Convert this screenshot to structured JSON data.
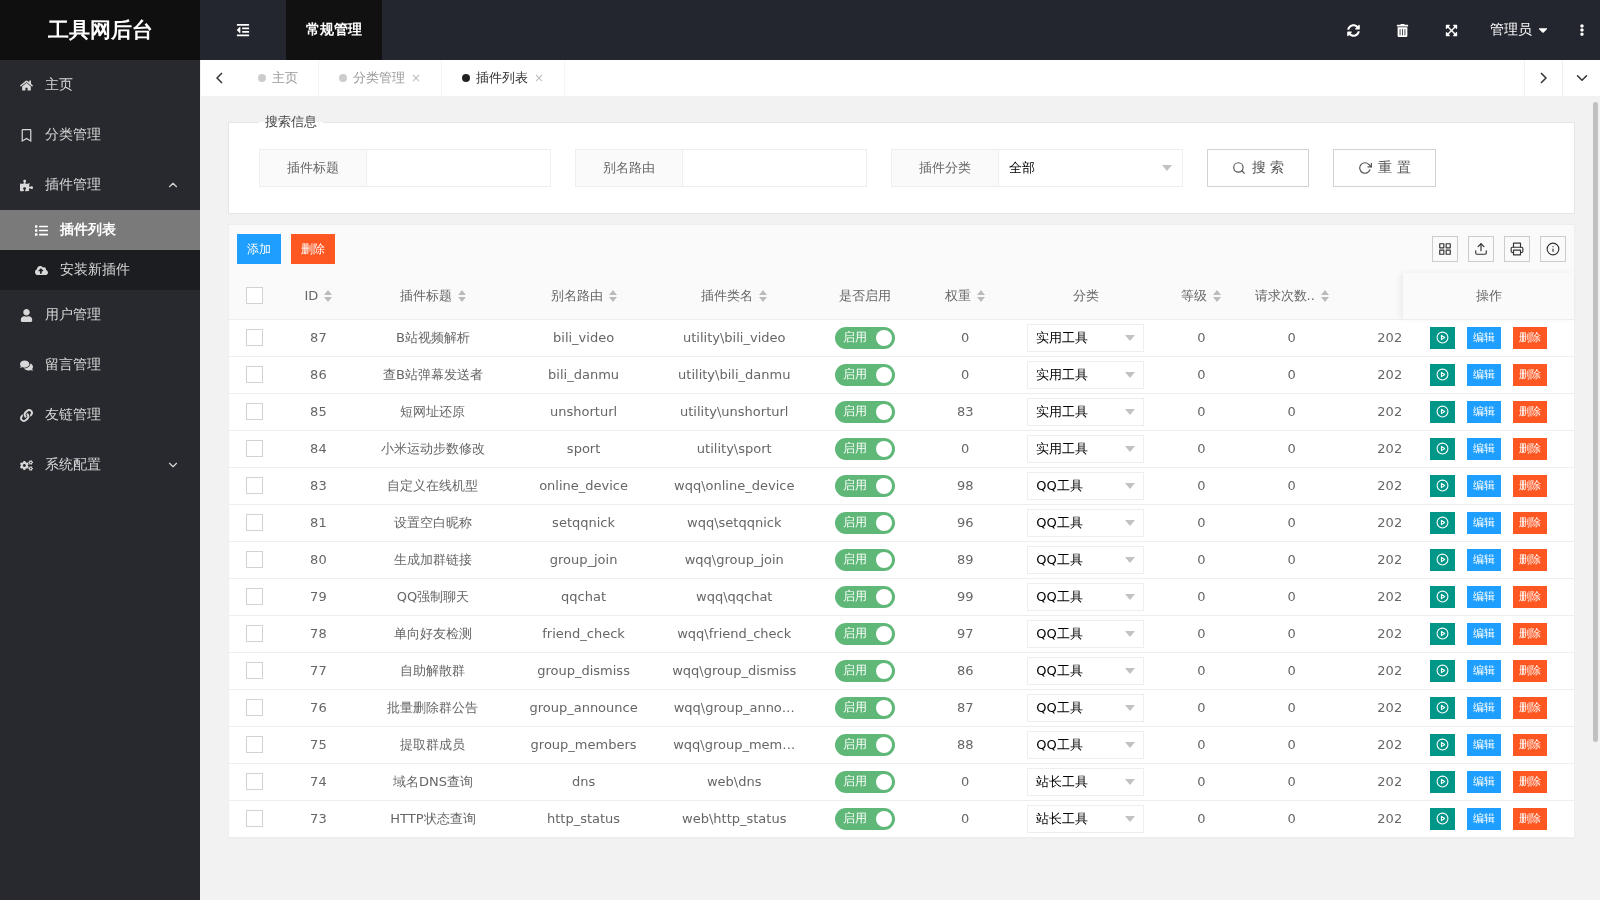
{
  "header": {
    "logo": "工具网后台",
    "nav": [
      {
        "label": "常规管理",
        "selected": true
      }
    ],
    "user": "管理员"
  },
  "sidebar": {
    "items": [
      {
        "label": "主页",
        "selected": false
      },
      {
        "label": "分类管理",
        "selected": false
      },
      {
        "label": "插件管理",
        "selected": false,
        "expanded": true,
        "children": [
          {
            "label": "插件列表",
            "selected": true
          },
          {
            "label": "安装新插件",
            "selected": false
          }
        ]
      },
      {
        "label": "用户管理",
        "selected": false
      },
      {
        "label": "留言管理",
        "selected": false
      },
      {
        "label": "友链管理",
        "selected": false
      },
      {
        "label": "系统配置",
        "selected": false,
        "expanded": false
      }
    ]
  },
  "tabs": [
    {
      "label": "主页",
      "selected": false
    },
    {
      "label": "分类管理",
      "selected": false,
      "close": "×"
    },
    {
      "label": "插件列表",
      "selected": true,
      "close": "×"
    }
  ],
  "search": {
    "legend": "搜索信息",
    "fields": [
      {
        "label": "插件标题",
        "kind": "text"
      },
      {
        "label": "别名路由",
        "kind": "text"
      },
      {
        "label": "插件分类",
        "kind": "select",
        "value": "全部"
      }
    ],
    "buttons": [
      "搜 索",
      "重 置"
    ]
  },
  "toolbar": {
    "buttons": [
      "添加",
      "删除"
    ]
  },
  "table": {
    "all_checked": false,
    "columns": [
      {
        "label": "ID",
        "sortable": true
      },
      {
        "label": "插件标题",
        "sortable": true
      },
      {
        "label": "别名路由",
        "sortable": true
      },
      {
        "label": "插件类名",
        "sortable": true
      },
      {
        "label": "是否启用",
        "sortable": false
      },
      {
        "label": "权重",
        "sortable": true
      },
      {
        "label": "分类",
        "sortable": false
      },
      {
        "label": "等级",
        "sortable": true
      },
      {
        "label": "请求次数..",
        "sortable": true
      },
      {
        "label": "操作",
        "sortable": false
      }
    ],
    "rows": [
      {
        "checked": false,
        "id": "87",
        "title": "B站视频解析",
        "alias": "bili_video",
        "class_name": "utility\\bili_video",
        "enabled": true,
        "toggle_text": "启用",
        "weight": "0",
        "category": "实用工具",
        "level": "0",
        "requests": "0",
        "column_10": "202",
        "edit": "编辑",
        "delete": "删除"
      },
      {
        "checked": false,
        "id": "86",
        "title": "查B站弹幕发送者",
        "alias": "bili_danmu",
        "class_name": "utility\\bili_danmu",
        "enabled": true,
        "toggle_text": "启用",
        "weight": "0",
        "category": "实用工具",
        "level": "0",
        "requests": "0",
        "column_10": "202",
        "edit": "编辑",
        "delete": "删除"
      },
      {
        "checked": false,
        "id": "85",
        "title": "短网址还原",
        "alias": "unshorturl",
        "class_name": "utility\\unshorturl",
        "enabled": true,
        "toggle_text": "启用",
        "weight": "83",
        "category": "实用工具",
        "level": "0",
        "requests": "0",
        "column_10": "202",
        "edit": "编辑",
        "delete": "删除"
      },
      {
        "checked": false,
        "id": "84",
        "title": "小米运动步数修改",
        "alias": "sport",
        "class_name": "utility\\sport",
        "enabled": true,
        "toggle_text": "启用",
        "weight": "0",
        "category": "实用工具",
        "level": "0",
        "requests": "0",
        "column_10": "202",
        "edit": "编辑",
        "delete": "删除"
      },
      {
        "checked": false,
        "id": "83",
        "title": "自定义在线机型",
        "alias": "online_device",
        "class_name": "wqq\\online_device",
        "enabled": true,
        "toggle_text": "启用",
        "weight": "98",
        "category": "QQ工具",
        "level": "0",
        "requests": "0",
        "column_10": "202",
        "edit": "编辑",
        "delete": "删除"
      },
      {
        "checked": false,
        "id": "81",
        "title": "设置空白昵称",
        "alias": "setqqnick",
        "class_name": "wqq\\setqqnick",
        "enabled": true,
        "toggle_text": "启用",
        "weight": "96",
        "category": "QQ工具",
        "level": "0",
        "requests": "0",
        "column_10": "202",
        "edit": "编辑",
        "delete": "删除"
      },
      {
        "checked": false,
        "id": "80",
        "title": "生成加群链接",
        "alias": "group_join",
        "class_name": "wqq\\group_join",
        "enabled": true,
        "toggle_text": "启用",
        "weight": "89",
        "category": "QQ工具",
        "level": "0",
        "requests": "0",
        "column_10": "202",
        "edit": "编辑",
        "delete": "删除"
      },
      {
        "checked": false,
        "id": "79",
        "title": "QQ强制聊天",
        "alias": "qqchat",
        "class_name": "wqq\\qqchat",
        "enabled": true,
        "toggle_text": "启用",
        "weight": "99",
        "category": "QQ工具",
        "level": "0",
        "requests": "0",
        "column_10": "202",
        "edit": "编辑",
        "delete": "删除"
      },
      {
        "checked": false,
        "id": "78",
        "title": "单向好友检测",
        "alias": "friend_check",
        "class_name": "wqq\\friend_check",
        "enabled": true,
        "toggle_text": "启用",
        "weight": "97",
        "category": "QQ工具",
        "level": "0",
        "requests": "0",
        "column_10": "202",
        "edit": "编辑",
        "delete": "删除"
      },
      {
        "checked": false,
        "id": "77",
        "title": "自助解散群",
        "alias": "group_dismiss",
        "class_name": "wqq\\group_dismiss",
        "enabled": true,
        "toggle_text": "启用",
        "weight": "86",
        "category": "QQ工具",
        "level": "0",
        "requests": "0",
        "column_10": "202",
        "edit": "编辑",
        "delete": "删除"
      },
      {
        "checked": false,
        "id": "76",
        "title": "批量删除群公告",
        "alias": "group_announce",
        "class_name": "wqq\\group_anno…",
        "enabled": true,
        "toggle_text": "启用",
        "weight": "87",
        "category": "QQ工具",
        "level": "0",
        "requests": "0",
        "column_10": "202",
        "edit": "编辑",
        "delete": "删除"
      },
      {
        "checked": false,
        "id": "75",
        "title": "提取群成员",
        "alias": "group_members",
        "class_name": "wqq\\group_mem…",
        "enabled": true,
        "toggle_text": "启用",
        "weight": "88",
        "category": "QQ工具",
        "level": "0",
        "requests": "0",
        "column_10": "202",
        "edit": "编辑",
        "delete": "删除"
      },
      {
        "checked": false,
        "id": "74",
        "title": "域名DNS查询",
        "alias": "dns",
        "class_name": "web\\dns",
        "enabled": true,
        "toggle_text": "启用",
        "weight": "0",
        "category": "站长工具",
        "level": "0",
        "requests": "0",
        "column_10": "202",
        "edit": "编辑",
        "delete": "删除"
      },
      {
        "checked": false,
        "id": "73",
        "title": "HTTP状态查询",
        "alias": "http_status",
        "class_name": "web\\http_status",
        "enabled": true,
        "toggle_text": "启用",
        "weight": "0",
        "category": "站长工具",
        "level": "0",
        "requests": "0",
        "column_10": "202",
        "edit": "编辑",
        "delete": "删除"
      }
    ]
  }
}
